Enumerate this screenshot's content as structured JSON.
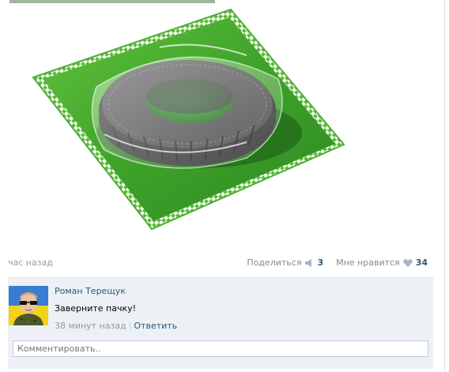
{
  "post": {
    "image_alt": "",
    "time": "час назад",
    "share_label": "Поделиться",
    "share_count": "3",
    "like_label": "Мне нравится",
    "like_count": "34",
    "colors": {
      "link": "#2B587A",
      "muted": "#999999",
      "packet_green": "#4CB030"
    }
  },
  "comment": {
    "author": "Роман Терещук",
    "text": "Заверните пачку!",
    "time": "38 минут назад",
    "separator": "|",
    "reply_label": "Ответить"
  },
  "comment_form": {
    "placeholder": "Комментировать.."
  }
}
